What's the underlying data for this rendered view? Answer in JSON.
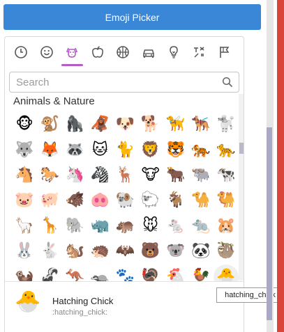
{
  "button": {
    "label": "Emoji Picker"
  },
  "categories": [
    {
      "name": "recent",
      "icon": "clock-icon",
      "active": false
    },
    {
      "name": "smileys",
      "icon": "smiley-icon",
      "active": false
    },
    {
      "name": "animals",
      "icon": "dog-icon",
      "active": true
    },
    {
      "name": "food",
      "icon": "apple-icon",
      "active": false
    },
    {
      "name": "activity",
      "icon": "ball-icon",
      "active": false
    },
    {
      "name": "travel",
      "icon": "car-icon",
      "active": false
    },
    {
      "name": "objects",
      "icon": "bulb-icon",
      "active": false
    },
    {
      "name": "symbols",
      "icon": "symbols-icon",
      "active": false
    },
    {
      "name": "flags",
      "icon": "flags-icon",
      "active": false
    }
  ],
  "search": {
    "placeholder": "Search",
    "value": ""
  },
  "section": {
    "title": "Animals & Nature"
  },
  "emojis": [
    [
      "🐵",
      "🐒",
      "🦍",
      "🦧",
      "🐶",
      "🐕",
      "🦮",
      "🐕‍🦺",
      "🐩"
    ],
    [
      "🐺",
      "🦊",
      "🦝",
      "🐱",
      "🐈",
      "🦁",
      "🐯",
      "🐅",
      "🐆"
    ],
    [
      "🐴",
      "🐎",
      "🦄",
      "🦓",
      "🦌",
      "🐮",
      "🐂",
      "🐃",
      "🐄"
    ],
    [
      "🐷",
      "🐖",
      "🐗",
      "🐽",
      "🐏",
      "🐑",
      "🐐",
      "🐪",
      "🐫"
    ],
    [
      "🦙",
      "🦒",
      "🐘",
      "🦏",
      "🦛",
      "🐭",
      "🐁",
      "🐀",
      "🐹"
    ],
    [
      "🐰",
      "🐇",
      "🐿️",
      "🦔",
      "🦇",
      "🐻",
      "🐨",
      "🐼",
      "🦥"
    ],
    [
      "🦦",
      "🦨",
      "🦘",
      "🦡",
      "🐾",
      "🦃",
      "🐔",
      "🐓",
      "🐣"
    ]
  ],
  "hovered": {
    "row": 6,
    "col": 8
  },
  "preview": {
    "emoji": "🐣",
    "name": "Hatching Chick",
    "short": ":hatching_chick:"
  },
  "tooltip": {
    "text": "hatching_chick"
  },
  "colors": {
    "button": "#3a87d8",
    "active_category": "#b55cc8",
    "right_bar": "#d9453b"
  }
}
